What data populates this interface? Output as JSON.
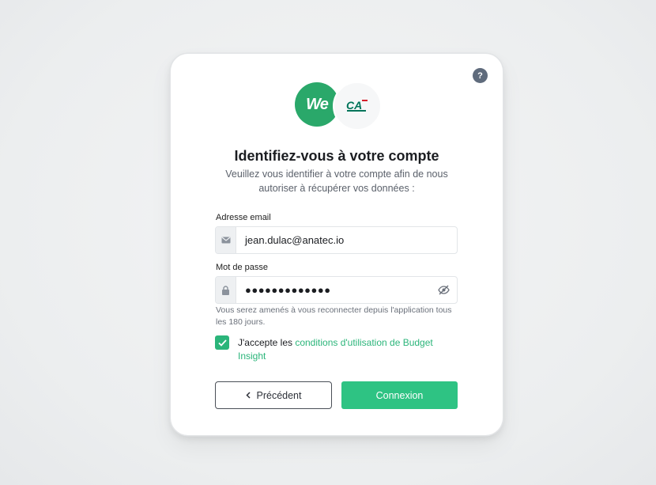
{
  "help": {
    "label": "?"
  },
  "logos": {
    "we_text": "We",
    "ca_text": "CA"
  },
  "title": "Identifiez-vous à votre compte",
  "subtitle": "Veuillez vous identifier à votre compte afin de nous autoriser à récupérer vos données :",
  "email": {
    "label": "Adresse email",
    "value": "jean.dulac@anatec.io",
    "icon": "envelope-icon"
  },
  "password": {
    "label": "Mot de passe",
    "value": "●●●●●●●●●●●●●",
    "icon": "lock-icon",
    "toggle_icon": "eye-slash-icon"
  },
  "hint": "Vous serez amenés à vous reconnecter depuis l'application tous les 180 jours.",
  "consent": {
    "checked": true,
    "prefix": "J'accepte les ",
    "link": "conditions d'utilisation de Budget Insight"
  },
  "buttons": {
    "prev": "Précédent",
    "prev_icon": "chevron-left-icon",
    "next": "Connexion"
  },
  "colors": {
    "accent": "#2ec383",
    "we_brand": "#2aa86a",
    "help_bg": "#5f6b7c"
  }
}
